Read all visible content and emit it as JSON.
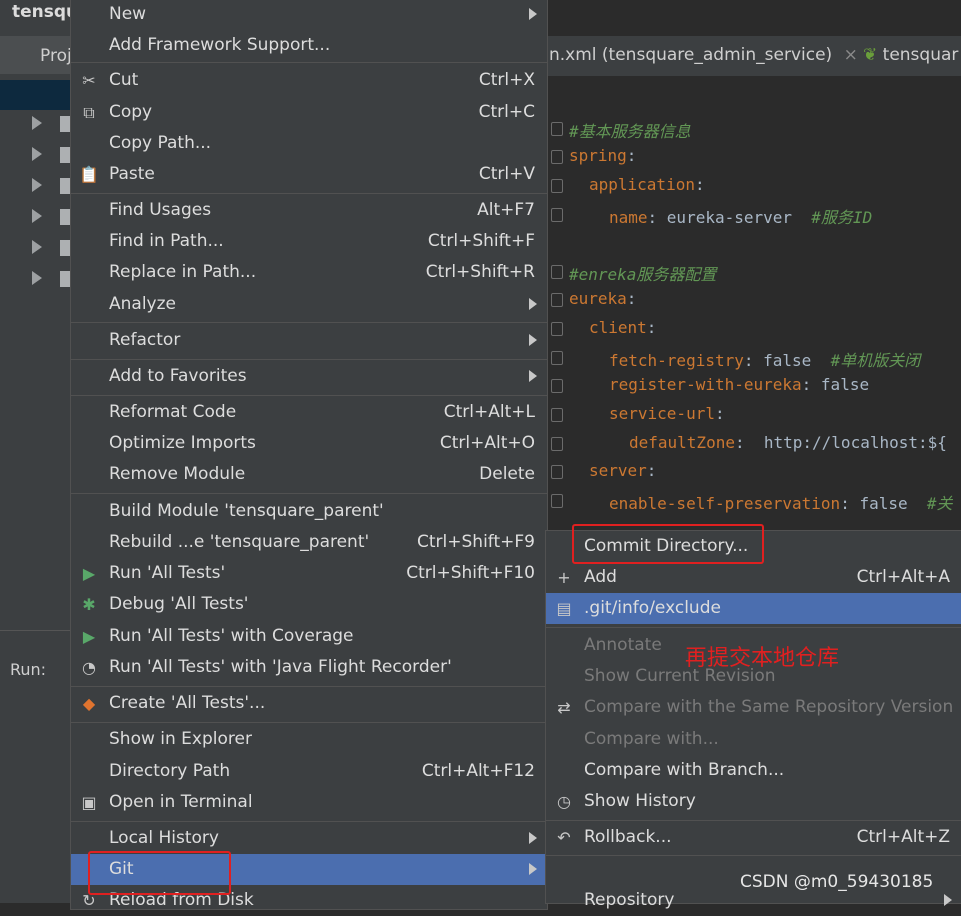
{
  "ide": {
    "project_title": "tensqu",
    "project_tab": "Proj",
    "run_label": "Run:",
    "tabs": [
      {
        "label": "n.xml (tensquare_admin_service)",
        "close": "×"
      },
      {
        "label": "tensquar"
      }
    ],
    "code_lines": [
      {
        "type": "comment",
        "text": "#基本服务器信息"
      },
      {
        "type": "key",
        "indent": 0,
        "key": "spring",
        "val": ""
      },
      {
        "type": "key",
        "indent": 1,
        "key": "application",
        "val": ""
      },
      {
        "type": "kv",
        "indent": 2,
        "key": "name",
        "val": "eureka-server",
        "comment": "#服务ID"
      },
      {
        "type": "blank"
      },
      {
        "type": "comment",
        "text": "#enreka服务器配置"
      },
      {
        "type": "key",
        "indent": 0,
        "key": "eureka",
        "val": ""
      },
      {
        "type": "key",
        "indent": 1,
        "key": "client",
        "val": ""
      },
      {
        "type": "kv",
        "indent": 2,
        "key": "fetch-registry",
        "val": "false",
        "comment": "#单机版关闭"
      },
      {
        "type": "kv",
        "indent": 2,
        "key": "register-with-eureka",
        "val": "false"
      },
      {
        "type": "key",
        "indent": 2,
        "key": "service-url",
        "val": ""
      },
      {
        "type": "kv",
        "indent": 3,
        "key": "defaultZone",
        "val": " http://localhost:${"
      },
      {
        "type": "key",
        "indent": 1,
        "key": "server",
        "val": ""
      },
      {
        "type": "kv",
        "indent": 2,
        "key": "enable-self-preservation",
        "val": "false",
        "comment": "#关"
      }
    ]
  },
  "context_menu": {
    "items": [
      {
        "label": "New",
        "submenu": true
      },
      {
        "label": "Add Framework Support..."
      },
      {
        "sep": true
      },
      {
        "label": "Cut",
        "shortcut": "Ctrl+X",
        "icon": "scissors-icon",
        "glyph": "✂"
      },
      {
        "label": "Copy",
        "shortcut": "Ctrl+C",
        "icon": "copy-icon",
        "glyph": "⧉"
      },
      {
        "label": "Copy Path..."
      },
      {
        "label": "Paste",
        "shortcut": "Ctrl+V",
        "icon": "clipboard-icon",
        "glyph": "📋"
      },
      {
        "sep": true
      },
      {
        "label": "Find Usages",
        "shortcut": "Alt+F7"
      },
      {
        "label": "Find in Path...",
        "shortcut": "Ctrl+Shift+F"
      },
      {
        "label": "Replace in Path...",
        "shortcut": "Ctrl+Shift+R"
      },
      {
        "label": "Analyze",
        "submenu": true
      },
      {
        "sep": true
      },
      {
        "label": "Refactor",
        "submenu": true
      },
      {
        "sep": true
      },
      {
        "label": "Add to Favorites",
        "submenu": true
      },
      {
        "sep": true
      },
      {
        "label": "Reformat Code",
        "shortcut": "Ctrl+Alt+L"
      },
      {
        "label": "Optimize Imports",
        "shortcut": "Ctrl+Alt+O"
      },
      {
        "label": "Remove Module",
        "shortcut": "Delete"
      },
      {
        "sep": true
      },
      {
        "label": "Build Module 'tensquare_parent'"
      },
      {
        "label": "Rebuild ...e 'tensquare_parent'",
        "shortcut": "Ctrl+Shift+F9"
      },
      {
        "label": "Run 'All Tests'",
        "shortcut": "Ctrl+Shift+F10",
        "icon": "run-icon",
        "glyph": "▶",
        "color": "#59a869"
      },
      {
        "label": "Debug 'All Tests'",
        "icon": "debug-icon",
        "glyph": "✱",
        "color": "#59a869"
      },
      {
        "label": "Run 'All Tests' with Coverage",
        "icon": "coverage-icon",
        "glyph": "▶",
        "color": "#59a869"
      },
      {
        "label": "Run 'All Tests' with 'Java Flight Recorder'",
        "icon": "profiler-icon",
        "glyph": "◔",
        "color": "#c8c8c8"
      },
      {
        "sep": true
      },
      {
        "label": "Create 'All Tests'...",
        "icon": "create-test-icon",
        "glyph": "◆",
        "color": "#e0742f"
      },
      {
        "sep": true
      },
      {
        "label": "Show in Explorer"
      },
      {
        "label": "Directory Path",
        "shortcut": "Ctrl+Alt+F12"
      },
      {
        "label": "Open in Terminal",
        "icon": "terminal-icon",
        "glyph": "▣",
        "color": "#c8c8c8"
      },
      {
        "sep": true
      },
      {
        "label": "Local History",
        "submenu": true
      },
      {
        "label": "Git",
        "submenu": true,
        "selected": true
      },
      {
        "label": "Reload from Disk",
        "icon": "reload-icon",
        "glyph": "↻",
        "color": "#c8c8c8"
      }
    ]
  },
  "git_menu": {
    "items": [
      {
        "label": "Commit Directory..."
      },
      {
        "label": "Add",
        "shortcut": "Ctrl+Alt+A",
        "icon": "plus-icon",
        "glyph": "+"
      },
      {
        "label": ".git/info/exclude",
        "selected": true,
        "icon": "file-icon",
        "glyph": "▤"
      },
      {
        "sep": true
      },
      {
        "label": "Annotate",
        "disabled": true
      },
      {
        "label": "Show Current Revision",
        "disabled": true
      },
      {
        "label": "Compare with the Same Repository Version",
        "disabled": true,
        "icon": "compare-icon",
        "glyph": "⇄"
      },
      {
        "label": "Compare with...",
        "disabled": true
      },
      {
        "label": "Compare with Branch..."
      },
      {
        "label": "Show History",
        "icon": "history-icon",
        "glyph": "◷"
      },
      {
        "sep": true
      },
      {
        "label": "Rollback...",
        "shortcut": "Ctrl+Alt+Z",
        "icon": "rollback-icon",
        "glyph": "↶"
      },
      {
        "sep": true
      },
      {
        "label": "Repository",
        "submenu": true
      }
    ]
  },
  "annotation": "再提交本地仓库",
  "watermark": "CSDN @m0_59430185",
  "colors": {
    "highlight": "#4b6eaf",
    "annotation_red": "#e02020",
    "menu_bg": "#3c3f41"
  }
}
